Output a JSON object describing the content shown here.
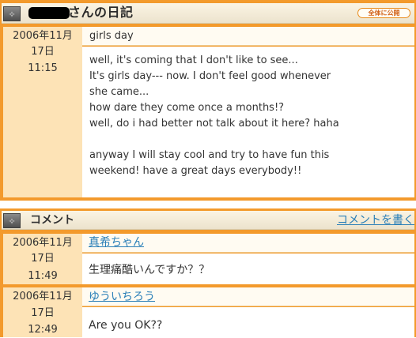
{
  "diary": {
    "title": "さんの日記",
    "public_label": "全体に公開",
    "date_line": "2006年11月",
    "day_line": "17日",
    "time": "11:15",
    "subject": "girls day",
    "body_lines": [
      "well, it's coming that I don't like to see...",
      "It's girls day--- now. I don't feel good whenever",
      "she came...",
      "how dare they come once a months!?",
      "well, do i had better not talk about it here? haha",
      "",
      "anyway I will stay cool and try to have fun this",
      "weekend! have a great days everybody!!"
    ]
  },
  "comments_section": {
    "title": "コメント",
    "write_link": "コメントを書く",
    "comments": [
      {
        "date_line": "2006年11月",
        "day_line": "17日",
        "time": "11:49",
        "author": "真希ちゃん",
        "text": "生理痛酷いんですか？？"
      },
      {
        "date_line": "2006年11月",
        "day_line": "17日",
        "time": "12:49",
        "author": "ゆういちろう",
        "text": "Are you OK??"
      }
    ]
  },
  "icons": {
    "section_icon": "diamond-ornament-icon"
  }
}
